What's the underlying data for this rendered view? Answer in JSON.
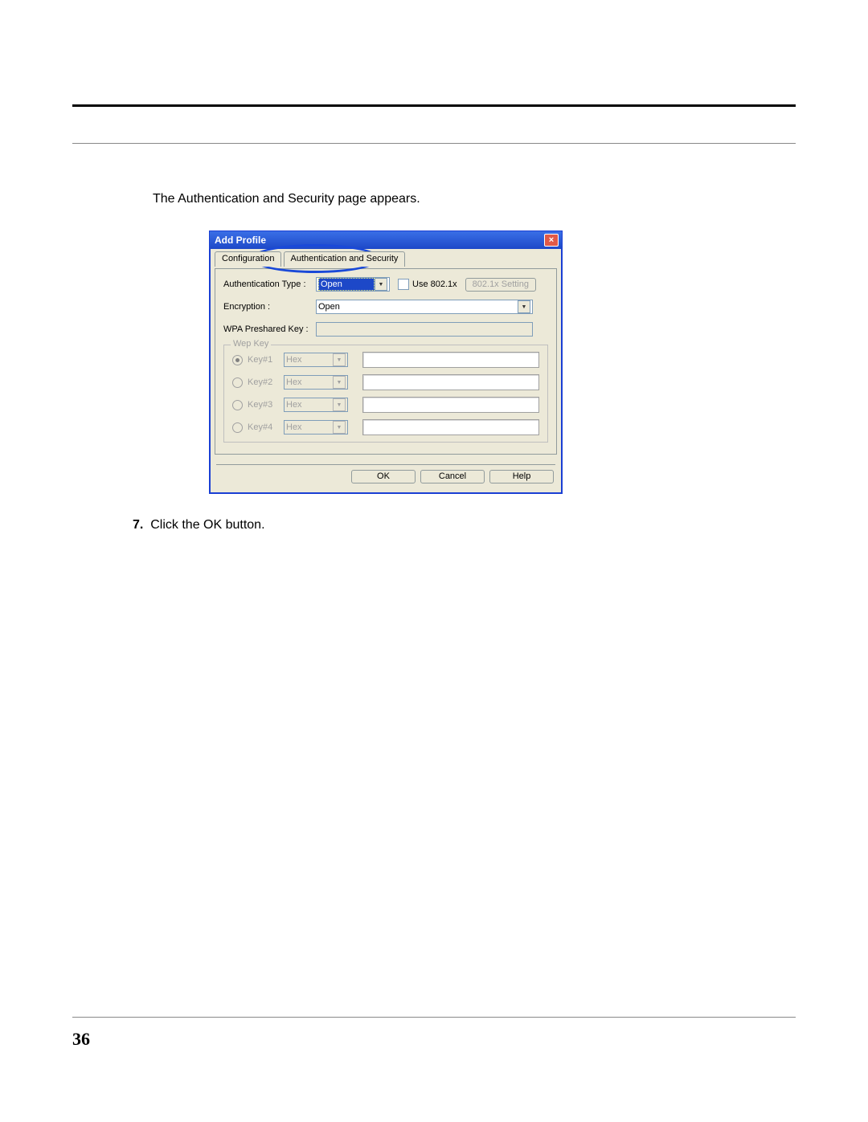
{
  "doc": {
    "intro_text": "The Authentication and Security page appears.",
    "step_number": "7.",
    "step_text": "Click the OK button.",
    "page_number": "36"
  },
  "dialog": {
    "title": "Add Profile",
    "close_glyph": "×",
    "tabs": {
      "configuration": "Configuration",
      "auth_security": "Authentication and Security"
    },
    "fields": {
      "auth_type_label": "Authentication Type :",
      "auth_type_value": "Open",
      "use_8021x_label": "Use 802.1x",
      "setting_8021x_label": "802.1x Setting",
      "encryption_label": "Encryption :",
      "encryption_value": "Open",
      "wpa_psk_label": "WPA Preshared Key :",
      "wpa_psk_value": ""
    },
    "wep": {
      "legend": "Wep Key",
      "format": "Hex",
      "keys": [
        {
          "name": "Key#1",
          "selected": true
        },
        {
          "name": "Key#2",
          "selected": false
        },
        {
          "name": "Key#3",
          "selected": false
        },
        {
          "name": "Key#4",
          "selected": false
        }
      ]
    },
    "buttons": {
      "ok": "OK",
      "cancel": "Cancel",
      "help": "Help"
    }
  }
}
